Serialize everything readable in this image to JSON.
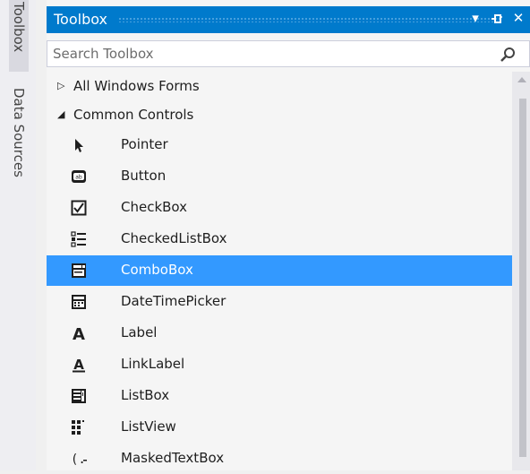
{
  "side_tabs": {
    "toolbox": "Toolbox",
    "data_sources": "Data Sources"
  },
  "titlebar": {
    "title": "Toolbox",
    "dropdown_glyph": "▾",
    "pin_glyph": "⊣",
    "close_glyph": "✕"
  },
  "search": {
    "placeholder": "Search Toolbox"
  },
  "groups": [
    {
      "label": "All Windows Forms",
      "expanded": false
    },
    {
      "label": "Common Controls",
      "expanded": true
    }
  ],
  "items": [
    {
      "label": "Pointer",
      "icon": "pointer-icon"
    },
    {
      "label": "Button",
      "icon": "button-icon"
    },
    {
      "label": "CheckBox",
      "icon": "checkbox-icon"
    },
    {
      "label": "CheckedListBox",
      "icon": "checkedlistbox-icon"
    },
    {
      "label": "ComboBox",
      "icon": "combobox-icon",
      "selected": true
    },
    {
      "label": "DateTimePicker",
      "icon": "datetimepicker-icon"
    },
    {
      "label": "Label",
      "icon": "label-icon"
    },
    {
      "label": "LinkLabel",
      "icon": "linklabel-icon"
    },
    {
      "label": "ListBox",
      "icon": "listbox-icon"
    },
    {
      "label": "ListView",
      "icon": "listview-icon"
    },
    {
      "label": "MaskedTextBox",
      "icon": "maskedtextbox-icon"
    }
  ],
  "colors": {
    "accent": "#007acc",
    "selection": "#3399ff"
  }
}
